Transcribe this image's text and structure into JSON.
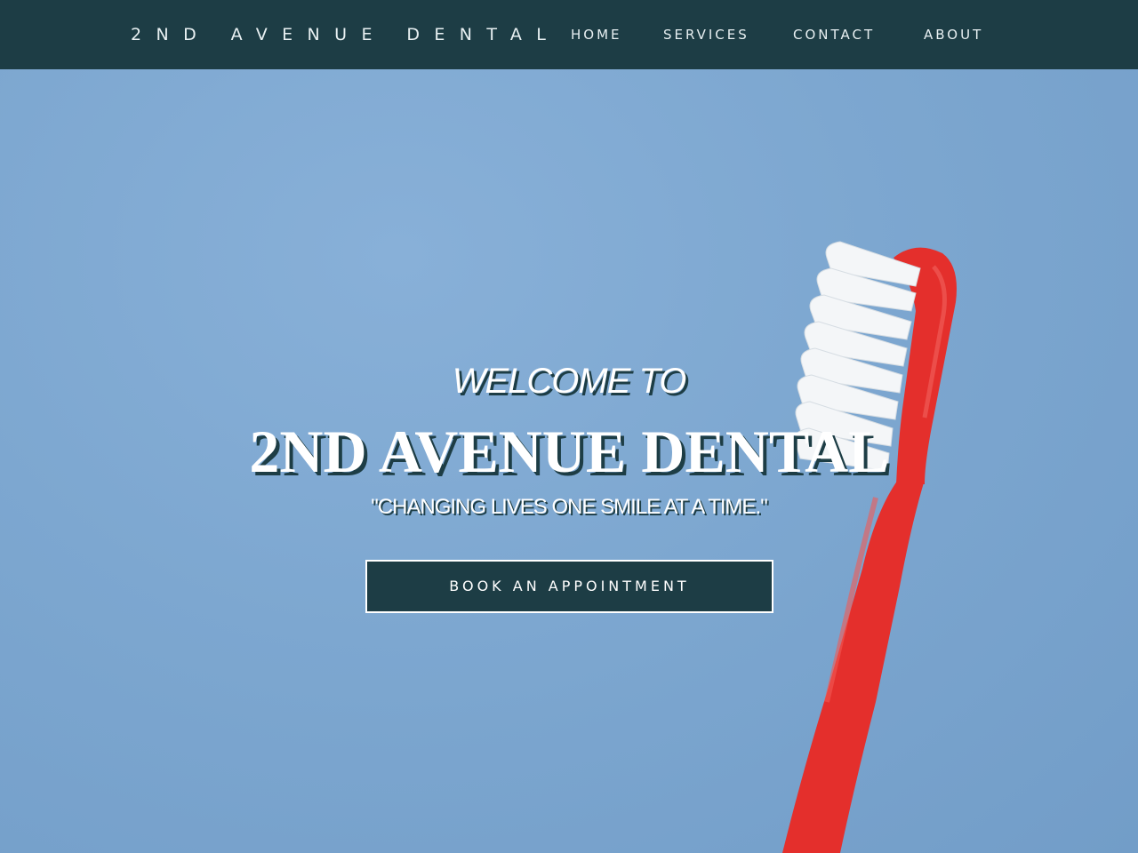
{
  "site": {
    "brand": "2ND AVENUE DENTAL"
  },
  "nav": {
    "items": [
      {
        "label": "HOME"
      },
      {
        "label": "SERVICES"
      },
      {
        "label": "CONTACT"
      },
      {
        "label": "ABOUT"
      }
    ]
  },
  "hero": {
    "welcome": "WELCOME TO",
    "title": "2ND AVENUE DENTAL",
    "tagline": "\"CHANGING LIVES ONE SMILE AT A TIME.\"",
    "cta_label": "BOOK AN APPOINTMENT",
    "image": "toothbrush-photo"
  },
  "colors": {
    "nav_bg": "#1d3d45",
    "hero_bg": "#7ba6d0",
    "toothbrush_red": "#e8312e",
    "bristles": "#ffffff"
  }
}
